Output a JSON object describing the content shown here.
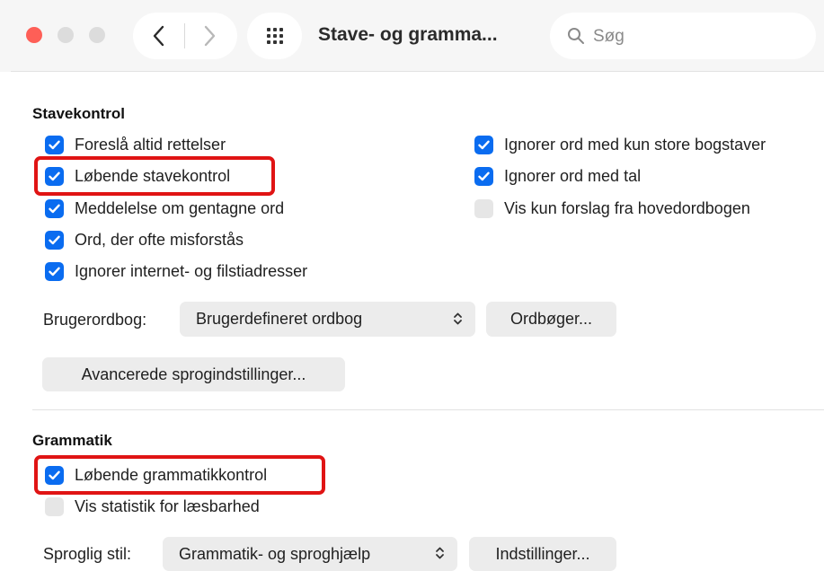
{
  "toolbar": {
    "title": "Stave- og gramma...",
    "search_placeholder": "Søg",
    "icons": [
      "close-light",
      "minimize-light",
      "zoom-light",
      "back-icon",
      "forward-icon",
      "grid-icon",
      "search-icon"
    ]
  },
  "spelling": {
    "title": "Stavekontrol",
    "left_options": [
      {
        "label": "Foreslå altid rettelser",
        "checked": true
      },
      {
        "label": "Løbende stavekontrol",
        "checked": true,
        "highlighted": true
      },
      {
        "label": "Meddelelse om gentagne ord",
        "checked": true
      },
      {
        "label": "Ord, der ofte misforstås",
        "checked": true
      },
      {
        "label": "Ignorer internet- og filstiadresser",
        "checked": true
      }
    ],
    "right_options": [
      {
        "label": "Ignorer ord med kun store bogstaver",
        "checked": true
      },
      {
        "label": "Ignorer ord med tal",
        "checked": true
      },
      {
        "label": "Vis kun forslag fra hovedordbogen",
        "checked": false
      }
    ],
    "dictionary_label": "Brugerordbog:",
    "dictionary_value": "Brugerdefineret ordbog",
    "dictionaries_button": "Ordbøger...",
    "advanced_button": "Avancerede sprogindstillinger..."
  },
  "grammar": {
    "title": "Grammatik",
    "options": [
      {
        "label": "Løbende grammatikkontrol",
        "checked": true,
        "highlighted": true
      },
      {
        "label": "Vis statistik for læsbarhed",
        "checked": false
      }
    ],
    "style_label": "Sproglig stil:",
    "style_value": "Grammatik- og sproghjælp",
    "settings_button": "Indstillinger..."
  },
  "colors": {
    "accent": "#0a6cf0",
    "highlight_border": "#e01414",
    "close_light": "#fe5f57"
  }
}
